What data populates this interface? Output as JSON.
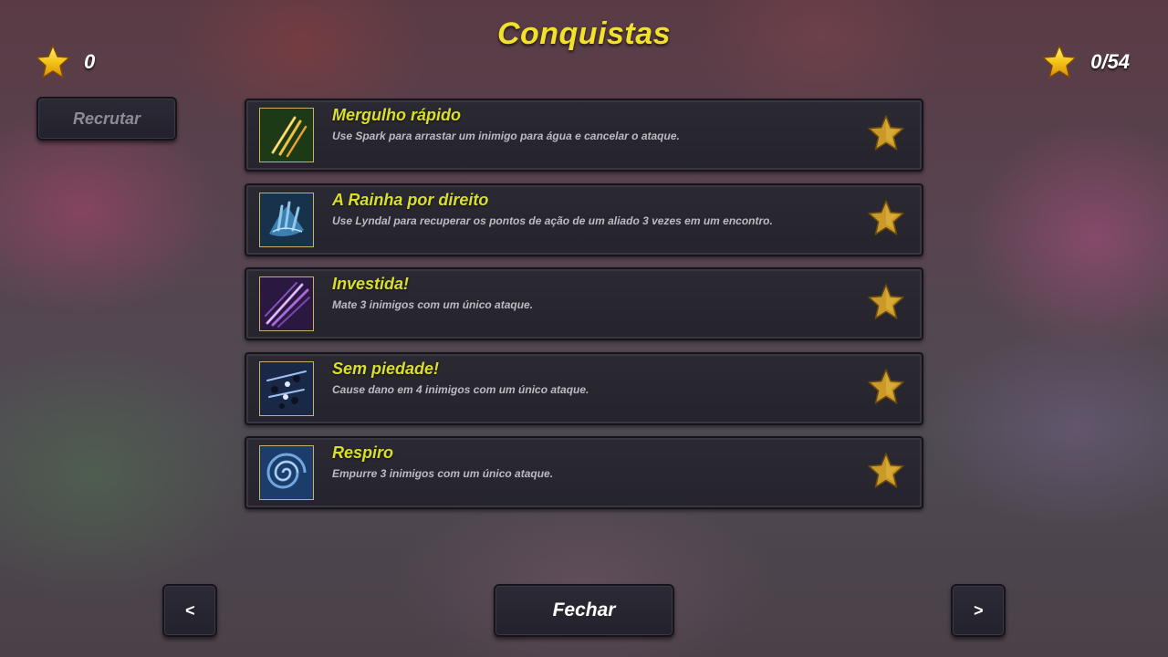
{
  "header": {
    "title": "Conquistas"
  },
  "counters": {
    "left_value": "0",
    "right_value": "0/54",
    "star_icon": "gold-star-icon"
  },
  "buttons": {
    "recruit": "Recrutar",
    "prev": "<",
    "next": ">",
    "close": "Fechar"
  },
  "achievements": [
    {
      "title": "Mergulho rápido",
      "description": "Use Spark para arrastar um inimigo para água e cancelar o ataque.",
      "icon": "claw-slash-icon",
      "completed": false
    },
    {
      "title": "A Rainha por direito",
      "description": "Use Lyndal para recuperar os pontos de ação de um aliado 3 vezes em um encontro.",
      "icon": "water-hand-icon",
      "completed": false
    },
    {
      "title": "Investida!",
      "description": "Mate 3 inimigos com um único ataque.",
      "icon": "spear-charge-icon",
      "completed": false
    },
    {
      "title": "Sem piedade!",
      "description": "Cause dano em 4 inimigos com um único ataque.",
      "icon": "multi-hit-icon",
      "completed": false
    },
    {
      "title": "Respiro",
      "description": "Empurre 3 inimigos com um único ataque.",
      "icon": "whirlwind-icon",
      "completed": false
    }
  ],
  "colors": {
    "title": "#f2e12a",
    "achievement_title": "#d8df2c",
    "panel": "#27252d",
    "star_gold": "#e0a820"
  }
}
